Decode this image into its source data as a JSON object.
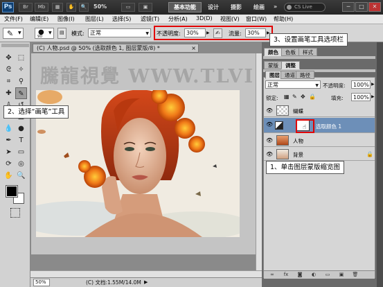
{
  "titlebar": {
    "logo": "Ps",
    "zoom": "50%",
    "workspaces": [
      "基本功能",
      "设计",
      "摄影",
      "绘画"
    ],
    "more": "»",
    "search_placeholder": "CS Live",
    "win_min": "─",
    "win_max": "□",
    "win_close": "✕"
  },
  "menu": [
    "文件(F)",
    "编辑(E)",
    "图像(I)",
    "图层(L)",
    "选择(S)",
    "滤镜(T)",
    "分析(A)",
    "3D(D)",
    "视图(V)",
    "窗口(W)",
    "帮助(H)"
  ],
  "options": {
    "brush_size": "90",
    "mode_label": "模式:",
    "mode_value": "正常",
    "opacity_label": "不透明度:",
    "opacity_value": "30%",
    "flow_label": "流量:",
    "flow_value": "30%"
  },
  "callouts": {
    "c1": "1、单击图层蒙版缩览图",
    "c2": "2、选择“画笔”工具",
    "c3": "3、设置画笔工具选项栏"
  },
  "document": {
    "tab_title": "(C) 人物.psd @ 50% (选取颜色 1, 图层蒙版/8) *",
    "tab_close": "×",
    "watermark": "騰龍視覺 WWW.TLVI.NET",
    "zoom": "50%",
    "info": "(C) 文档:1.55M/14.0M"
  },
  "panels": {
    "top_tabs": [
      "颜色",
      "色板",
      "样式"
    ],
    "mid_tabs": [
      "蒙版",
      "调整"
    ],
    "layers_tabs": [
      "图层",
      "通道",
      "路径"
    ],
    "blend_mode": "正常",
    "opacity_label": "不透明度:",
    "opacity_value": "100%",
    "lock_label": "锁定:",
    "fill_label": "填充:",
    "fill_value": "100%",
    "layers": [
      {
        "name": "蝴蝶"
      },
      {
        "name": "选取颜色 1"
      },
      {
        "name": "人物"
      },
      {
        "name": "背景"
      }
    ]
  },
  "colors": {
    "selection_blue": "#6d8fb8",
    "highlight_red": "#e10000"
  }
}
